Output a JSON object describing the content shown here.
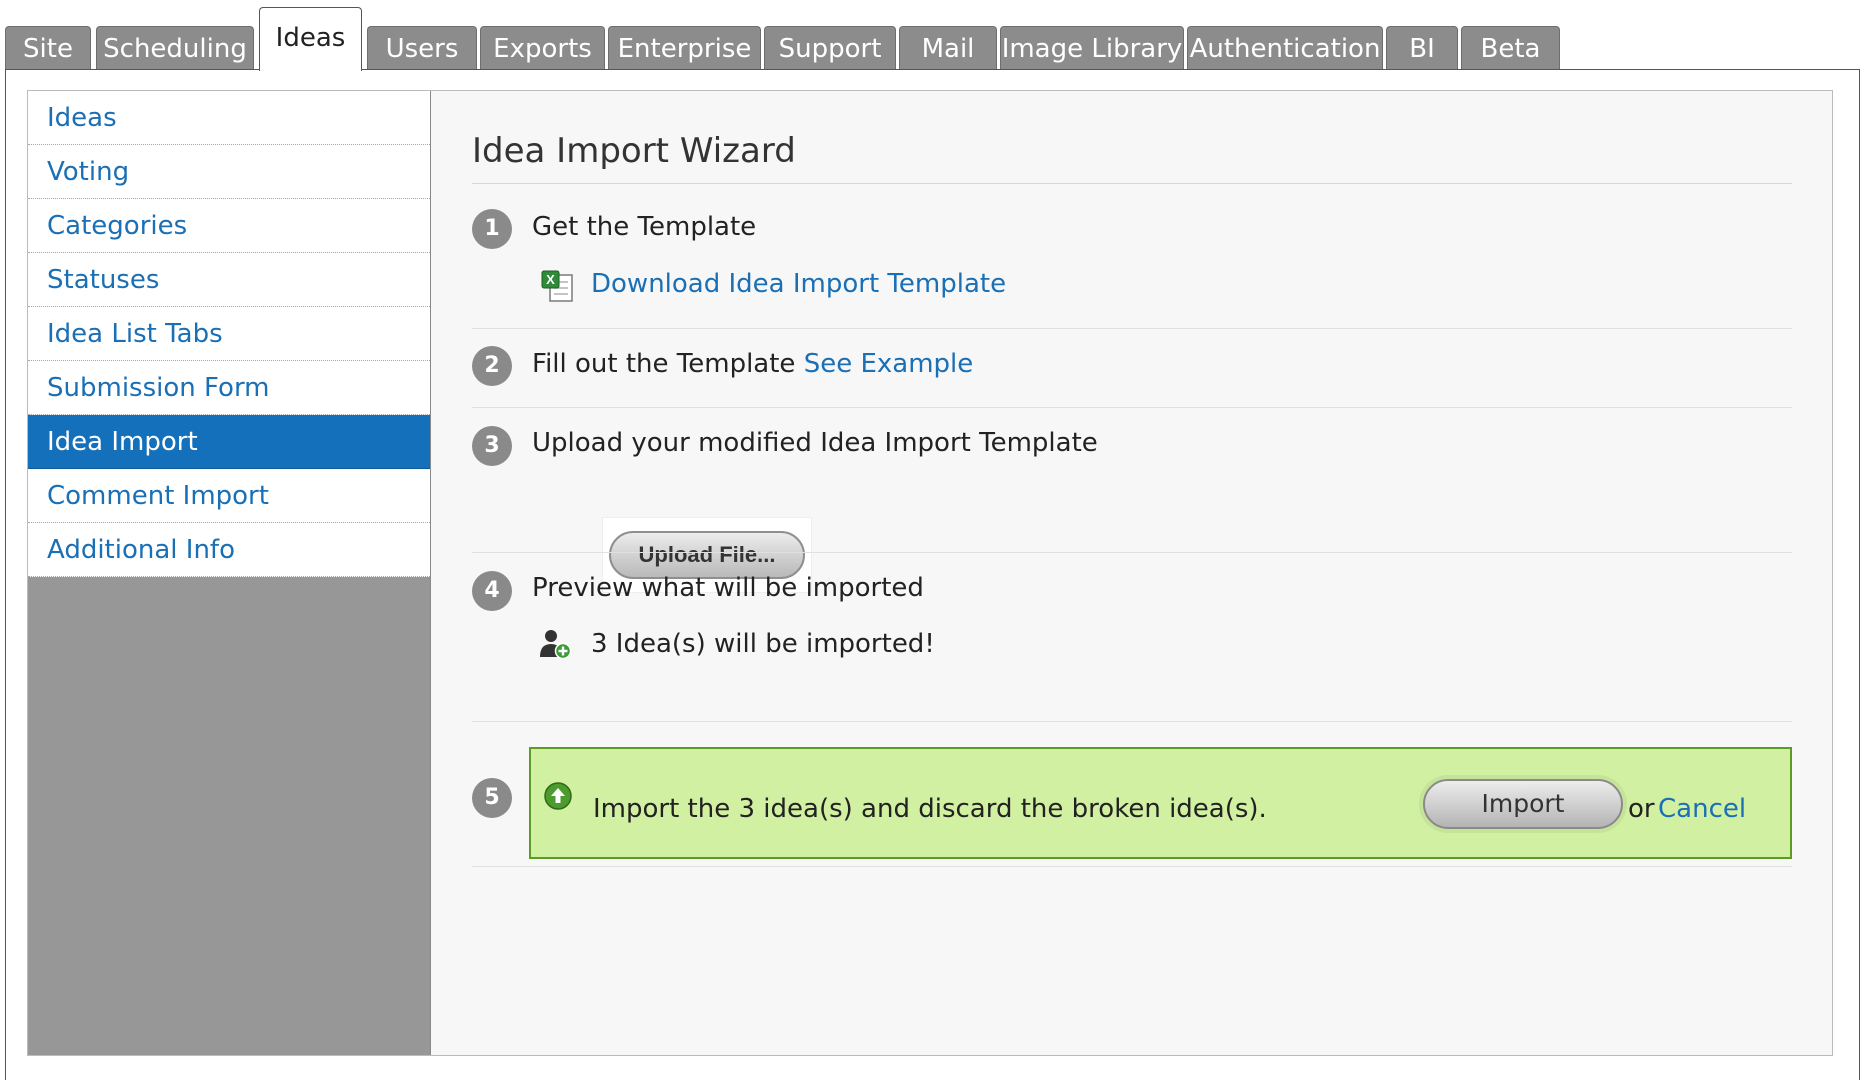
{
  "tabs": [
    {
      "label": "Site"
    },
    {
      "label": "Scheduling"
    },
    {
      "label": "Ideas",
      "active": true
    },
    {
      "label": "Users"
    },
    {
      "label": "Exports"
    },
    {
      "label": "Enterprise"
    },
    {
      "label": "Support"
    },
    {
      "label": "Mail"
    },
    {
      "label": "Image Library"
    },
    {
      "label": "Authentication"
    },
    {
      "label": "BI"
    },
    {
      "label": "Beta"
    }
  ],
  "sidebar": {
    "items": [
      {
        "label": "Ideas"
      },
      {
        "label": "Voting"
      },
      {
        "label": "Categories"
      },
      {
        "label": "Statuses"
      },
      {
        "label": "Idea List Tabs"
      },
      {
        "label": "Submission Form"
      },
      {
        "label": "Idea Import",
        "active": true
      },
      {
        "label": "Comment Import"
      },
      {
        "label": "Additional Info"
      }
    ]
  },
  "wizard": {
    "title": "Idea Import Wizard",
    "steps": [
      {
        "number": "1",
        "text": "Get the Template",
        "link": "Download Idea Import Template"
      },
      {
        "number": "2",
        "text": "Fill out the Template",
        "link": "See Example"
      },
      {
        "number": "3",
        "text": "Upload your modified Idea Import Template",
        "button": "Upload File..."
      },
      {
        "number": "4",
        "text": "Preview what will be imported",
        "result": "3 Idea(s) will be imported!"
      },
      {
        "number": "5"
      }
    ],
    "import_box": {
      "message": "Import the 3 idea(s) and discard the  broken idea(s).",
      "import_button": "Import",
      "or_text": "or",
      "cancel_link": "Cancel"
    }
  },
  "colors": {
    "tab_inactive": "#8c8c8c",
    "link": "#1a6fb5",
    "sidebar_active": "#1470bb",
    "import_box_bg": "#d2f0a1",
    "import_box_border": "#5c9b24"
  }
}
